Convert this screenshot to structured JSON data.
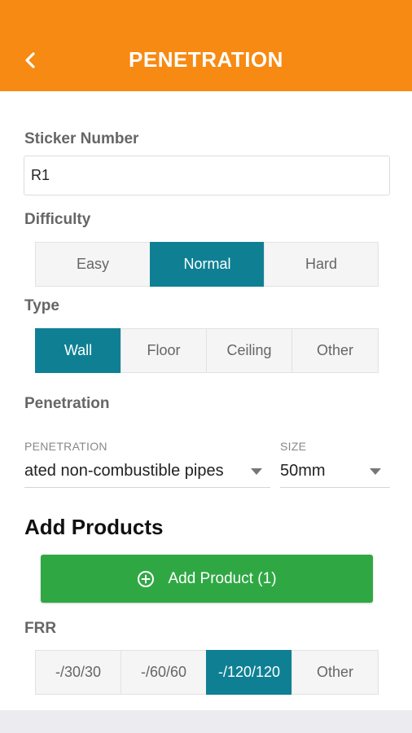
{
  "header": {
    "title": "PENETRATION",
    "back_icon": "chevron-left-icon"
  },
  "sticker": {
    "label": "Sticker Number",
    "value": "R1"
  },
  "difficulty": {
    "label": "Difficulty",
    "options": [
      "Easy",
      "Normal",
      "Hard"
    ],
    "selected": "Normal"
  },
  "type": {
    "label": "Type",
    "options": [
      "Wall",
      "Floor",
      "Ceiling",
      "Other"
    ],
    "selected": "Wall"
  },
  "penetration": {
    "label": "Penetration",
    "penetration_caption": "PENETRATION",
    "penetration_value": "ated non-combustible pipes",
    "size_caption": "SIZE",
    "size_value": "50mm"
  },
  "products": {
    "title": "Add Products",
    "add_button_label": "Add Product (1)",
    "add_icon": "plus-circle-icon"
  },
  "frr": {
    "label": "FRR",
    "options": [
      "-/30/30",
      "-/60/60",
      "-/120/120",
      "Other"
    ],
    "selected": "-/120/120"
  },
  "colors": {
    "header": "#f78a12",
    "selected_segment": "#0f8094",
    "add_button": "#2fa844"
  }
}
